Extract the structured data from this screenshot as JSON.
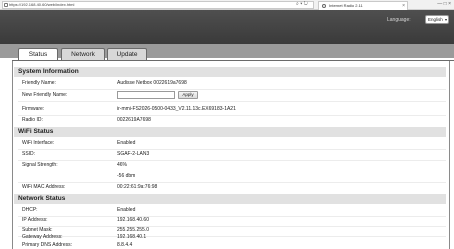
{
  "browser": {
    "url": "https://192.168.40.60/web/index.html",
    "tab_title": "Internet Radio 2.11",
    "addr_icons": "⌕ ▾ ↻",
    "tab_close": "×",
    "window_controls": "— □ ×"
  },
  "header": {
    "language_label": "Language:",
    "language_value": "English",
    "language_chevron": "▾"
  },
  "tabs": [
    {
      "label": "Status",
      "active": true
    },
    {
      "label": "Network",
      "active": false
    },
    {
      "label": "Update",
      "active": false
    }
  ],
  "system": {
    "title": "System Information",
    "friendly_name_label": "Friendly Name:",
    "friendly_name_value": "Audisse Netbox 0022619a7698",
    "new_friendly_name_label": "New Friendly Name:",
    "new_friendly_name_value": "",
    "apply_label": "Apply",
    "firmware_label": "Firmware:",
    "firmware_value": "ir-mmi-FS2026-0500-0433_V2.11.13c.EX69183-1A21",
    "radio_id_label": "Radio ID:",
    "radio_id_value": "0022619A7698"
  },
  "wifi": {
    "title": "WiFi Status",
    "interface_label": "WiFi Interface:",
    "interface_value": "Enabled",
    "ssid_label": "SSID:",
    "ssid_value": "SGAF-2-LAN3",
    "signal_label": "Signal Strength:",
    "signal_value": "46%",
    "signal_dbm": "-56 dbm",
    "mac_label": "WiFi MAC Address:",
    "mac_value": "00:22:61:9a:76:98"
  },
  "network": {
    "title": "Network Status",
    "dhcp_label": "DHCP:",
    "dhcp_value": "Enabled",
    "ip_label": "IP Address:",
    "ip_value": "192.168.40.60",
    "mask_label": "Subnet Mask:",
    "mask_value": "255.255.255.0",
    "gateway_label": "Gateway Address:",
    "gateway_value": "192.168.40.1",
    "dns_label": "Primary DNS Address:",
    "dns_value": "8.8.4.4"
  }
}
